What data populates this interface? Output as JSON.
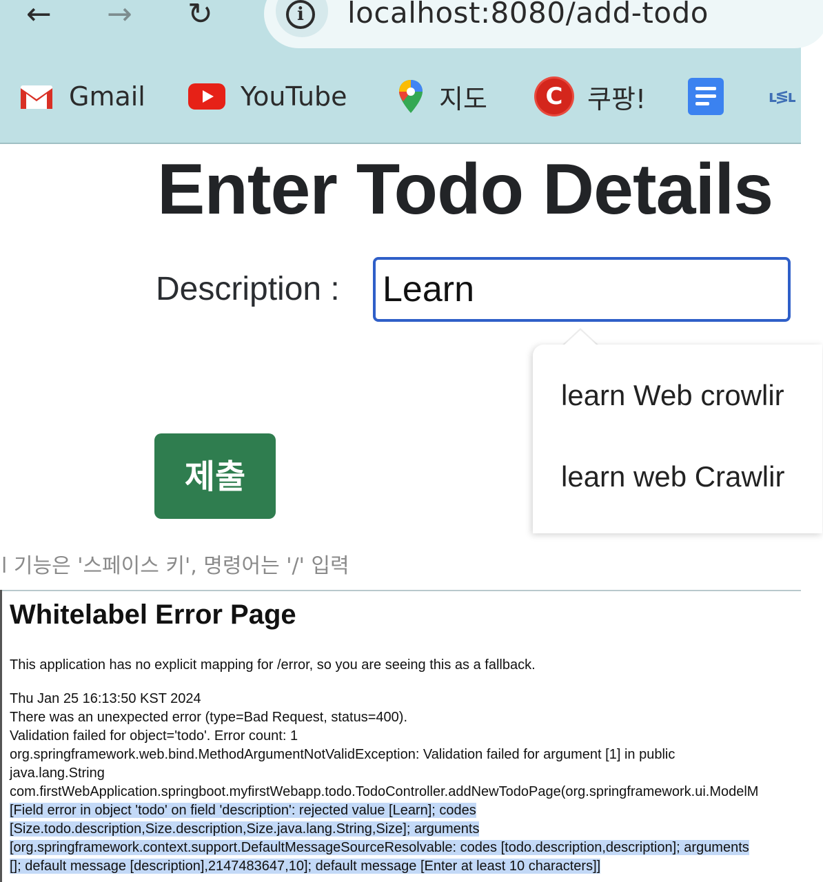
{
  "browser": {
    "url_host": "localhost:8080/add-todo",
    "bookmarks": [
      {
        "label": "Gmail",
        "icon": "gmail-icon"
      },
      {
        "label": "YouTube",
        "icon": "youtube-icon"
      },
      {
        "label": "지도",
        "icon": "maps-icon"
      },
      {
        "label": "쿠팡!",
        "icon": "coupang-icon"
      },
      {
        "label": "",
        "icon": "docs-icon"
      },
      {
        "label": "",
        "icon": "partial-bookmark-icon"
      }
    ],
    "colors": {
      "toolbar": "#bfe0e4",
      "accent": "#2f5fc8"
    }
  },
  "form": {
    "title": "Enter Todo Details",
    "description_label": "Description :",
    "description_value": "Learn",
    "autocomplete": [
      "learn Web crowlir",
      "learn web Crawlir"
    ],
    "submit_label": "제출",
    "submit_color": "#2f7d4f"
  },
  "hint": "l 기능은 '스페이스 키', 명령어는 '/' 입력",
  "error_page": {
    "title": "Whitelabel Error Page",
    "fallback": "This application has no explicit mapping for /error, so you are seeing this as a fallback.",
    "timestamp": "Thu Jan 25 16:13:50 KST 2024",
    "lines": [
      "There was an unexpected error (type=Bad Request, status=400).",
      "Validation failed for object='todo'. Error count: 1",
      "org.springframework.web.bind.MethodArgumentNotValidException: Validation failed for argument [1] in public",
      "java.lang.String",
      "com.firstWebApplication.springboot.myfirstWebapp.todo.TodoController.addNewTodoPage(org.springframework.ui.ModelM"
    ],
    "highlighted_lines": [
      "[Field error in object 'todo' on field 'description': rejected value [Learn]; codes",
      "[Size.todo.description,Size.description,Size.java.lang.String,Size]; arguments",
      "[org.springframework.context.support.DefaultMessageSourceResolvable: codes [todo.description,description]; arguments",
      "[]; default message [description],2147483647,10]; default message [Enter at least 10 characters]]"
    ],
    "highlight_color": "#c3d9f7"
  }
}
